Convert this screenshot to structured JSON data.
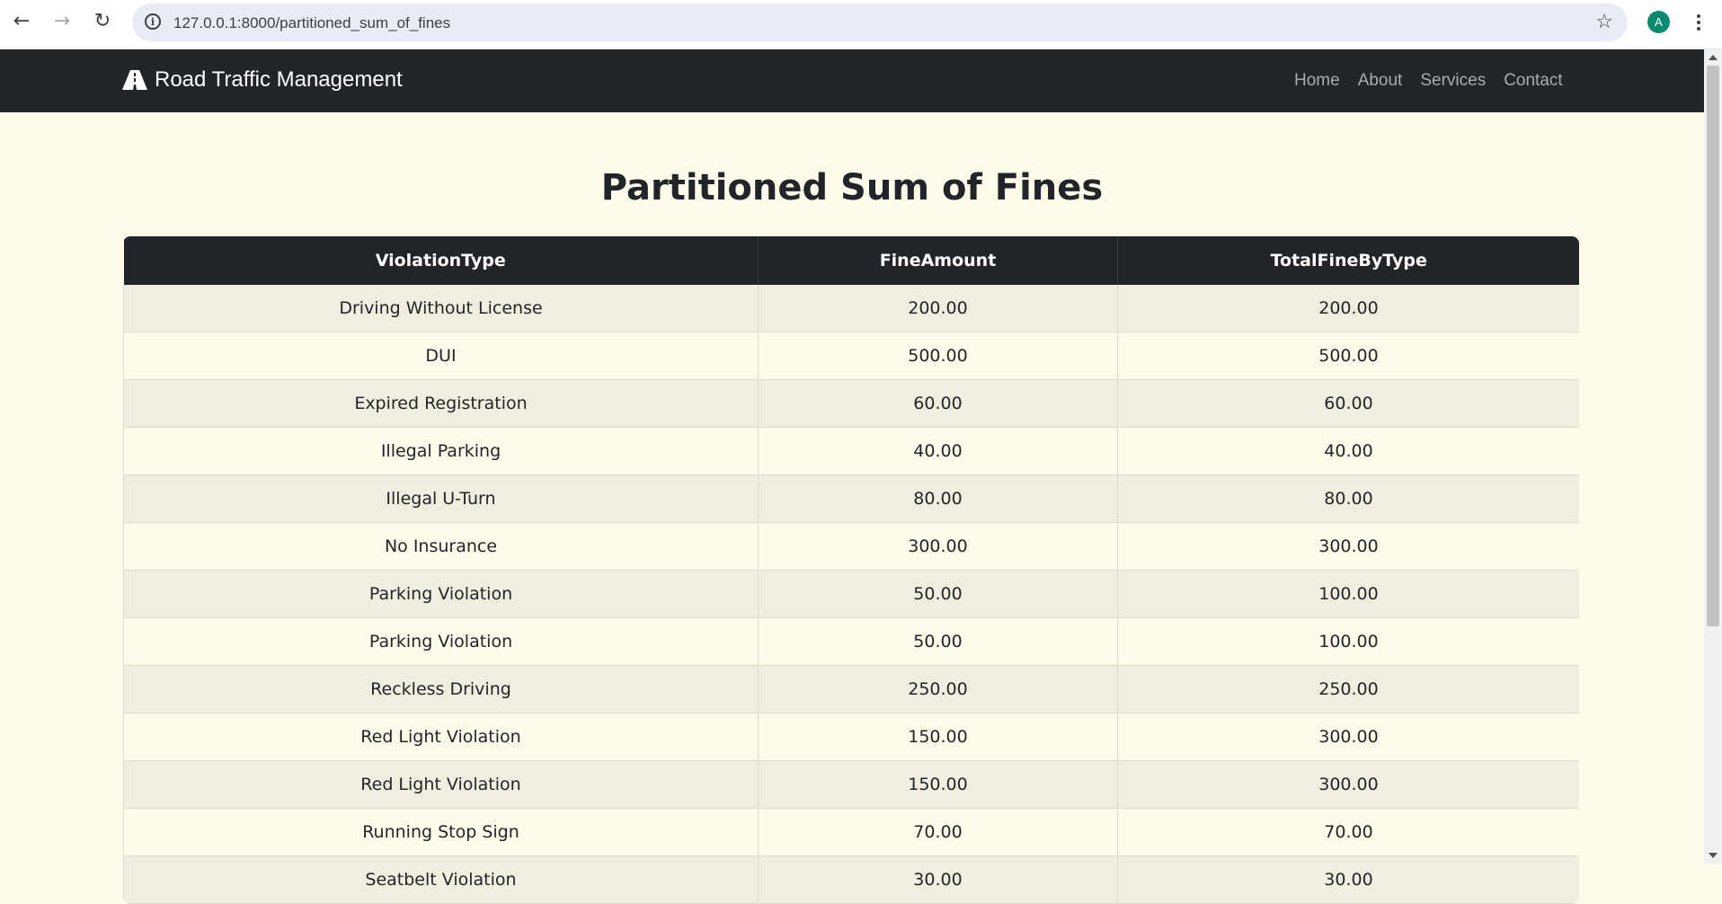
{
  "browser": {
    "url": "127.0.0.1:8000/partitioned_sum_of_fines",
    "profile_initial": "A"
  },
  "navbar": {
    "brand": "Road Traffic Management",
    "links": [
      "Home",
      "About",
      "Services",
      "Contact"
    ]
  },
  "page": {
    "title": "Partitioned Sum of Fines"
  },
  "table": {
    "headers": [
      "ViolationType",
      "FineAmount",
      "TotalFineByType"
    ],
    "rows": [
      [
        "Driving Without License",
        "200.00",
        "200.00"
      ],
      [
        "DUI",
        "500.00",
        "500.00"
      ],
      [
        "Expired Registration",
        "60.00",
        "60.00"
      ],
      [
        "Illegal Parking",
        "40.00",
        "40.00"
      ],
      [
        "Illegal U-Turn",
        "80.00",
        "80.00"
      ],
      [
        "No Insurance",
        "300.00",
        "300.00"
      ],
      [
        "Parking Violation",
        "50.00",
        "100.00"
      ],
      [
        "Parking Violation",
        "50.00",
        "100.00"
      ],
      [
        "Reckless Driving",
        "250.00",
        "250.00"
      ],
      [
        "Red Light Violation",
        "150.00",
        "300.00"
      ],
      [
        "Red Light Violation",
        "150.00",
        "300.00"
      ],
      [
        "Running Stop Sign",
        "70.00",
        "70.00"
      ],
      [
        "Seatbelt Violation",
        "30.00",
        "30.00"
      ]
    ]
  },
  "colors": {
    "navbar_bg": "#212529",
    "page_bg": "#fffbea",
    "row_stripe": "#f1eddf",
    "profile_bg": "#0b8a72"
  }
}
